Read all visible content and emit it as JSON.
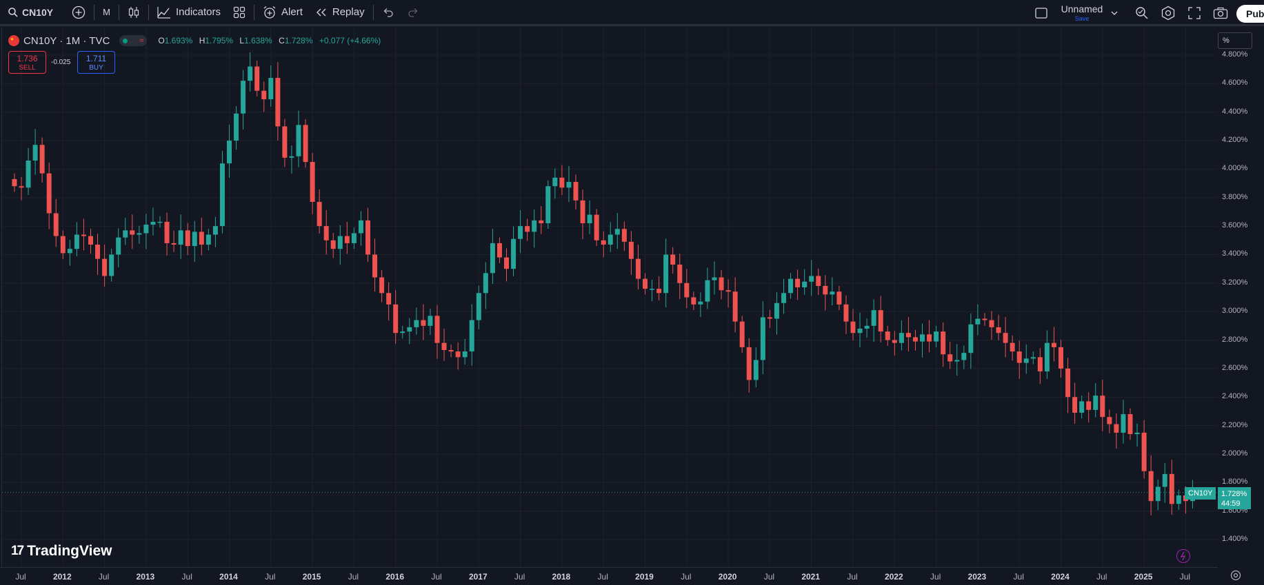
{
  "toolbar": {
    "symbol": "CN10Y",
    "interval": "M",
    "indicators_label": "Indicators",
    "alert_label": "Alert",
    "replay_label": "Replay",
    "layout_name": "Unnamed",
    "layout_save": "Save",
    "publish_label": "Publ"
  },
  "legend": {
    "title": "CN10Y · 1M · TVC",
    "open": "O",
    "open_val": "1.693%",
    "high": "H",
    "high_val": "1.795%",
    "low": "L",
    "low_val": "1.638%",
    "close": "C",
    "close_val": "1.728%",
    "change": "+0.077 (+4.66%)"
  },
  "trade": {
    "sell_price": "1.736",
    "sell_label": "SELL",
    "spread": "-0.025",
    "buy_price": "1.711",
    "buy_label": "BUY"
  },
  "price_axis": {
    "scale_label": "%",
    "current_symbol": "CN10Y",
    "current_price": "1.728%",
    "countdown": "44:59"
  },
  "branding": {
    "logo_text": "TradingView"
  },
  "colors": {
    "up": "#26a69a",
    "down": "#ef5350",
    "background": "#131722",
    "grid": "#1e222d"
  },
  "chart_data": {
    "type": "candlestick",
    "symbol": "CN10Y",
    "interval": "1M",
    "ylim": [
      1.3,
      4.85
    ],
    "y_ticks": [
      "4.800%",
      "4.600%",
      "4.400%",
      "4.200%",
      "4.000%",
      "3.800%",
      "3.600%",
      "3.400%",
      "3.200%",
      "3.000%",
      "2.800%",
      "2.600%",
      "2.400%",
      "2.200%",
      "2.000%",
      "1.800%",
      "1.600%",
      "1.400%"
    ],
    "x_ticks": [
      "Jul",
      "2012",
      "Jul",
      "2013",
      "Jul",
      "2014",
      "Jul",
      "2015",
      "Jul",
      "2016",
      "Jul",
      "2017",
      "Jul",
      "2018",
      "Jul",
      "2019",
      "Jul",
      "2020",
      "Jul",
      "2021",
      "Jul",
      "2022",
      "Jul",
      "2023",
      "Jul",
      "2024",
      "Jul",
      "2025",
      "Jul"
    ],
    "start": "2011-06",
    "closes": [
      3.88,
      3.87,
      4.06,
      4.17,
      3.97,
      3.69,
      3.53,
      3.41,
      3.44,
      3.54,
      3.53,
      3.47,
      3.37,
      3.25,
      3.4,
      3.52,
      3.57,
      3.54,
      3.55,
      3.61,
      3.63,
      3.63,
      3.48,
      3.47,
      3.57,
      3.46,
      3.56,
      3.47,
      3.54,
      3.6,
      4.04,
      4.2,
      4.39,
      4.62,
      4.72,
      4.55,
      4.49,
      4.64,
      4.3,
      4.08,
      4.09,
      4.31,
      4.05,
      3.77,
      3.6,
      3.5,
      3.44,
      3.53,
      3.48,
      3.55,
      3.64,
      3.4,
      3.24,
      3.13,
      3.05,
      2.85,
      2.86,
      2.89,
      2.94,
      2.9,
      2.97,
      2.78,
      2.73,
      2.72,
      2.68,
      2.72,
      2.94,
      3.13,
      3.27,
      3.48,
      3.38,
      3.3,
      3.51,
      3.6,
      3.56,
      3.64,
      3.62,
      3.88,
      3.94,
      3.87,
      3.91,
      3.78,
      3.62,
      3.68,
      3.5,
      3.47,
      3.54,
      3.58,
      3.49,
      3.37,
      3.23,
      3.16,
      3.16,
      3.13,
      3.4,
      3.33,
      3.2,
      3.1,
      3.05,
      3.07,
      3.22,
      3.24,
      3.15,
      3.14,
      2.93,
      2.75,
      2.52,
      2.66,
      2.96,
      2.95,
      3.06,
      3.13,
      3.23,
      3.17,
      3.21,
      3.25,
      3.18,
      3.12,
      3.14,
      3.05,
      2.93,
      2.85,
      2.88,
      2.9,
      3.01,
      2.86,
      2.8,
      2.78,
      2.85,
      2.82,
      2.79,
      2.84,
      2.79,
      2.86,
      2.7,
      2.65,
      2.66,
      2.71,
      2.91,
      2.95,
      2.94,
      2.89,
      2.85,
      2.78,
      2.72,
      2.64,
      2.67,
      2.68,
      2.58,
      2.78,
      2.75,
      2.6,
      2.4,
      2.29,
      2.37,
      2.31,
      2.41,
      2.26,
      2.21,
      2.15,
      2.28,
      2.14,
      2.15,
      1.88,
      1.67,
      1.77,
      1.86,
      1.65,
      1.71,
      1.67,
      1.73
    ]
  }
}
